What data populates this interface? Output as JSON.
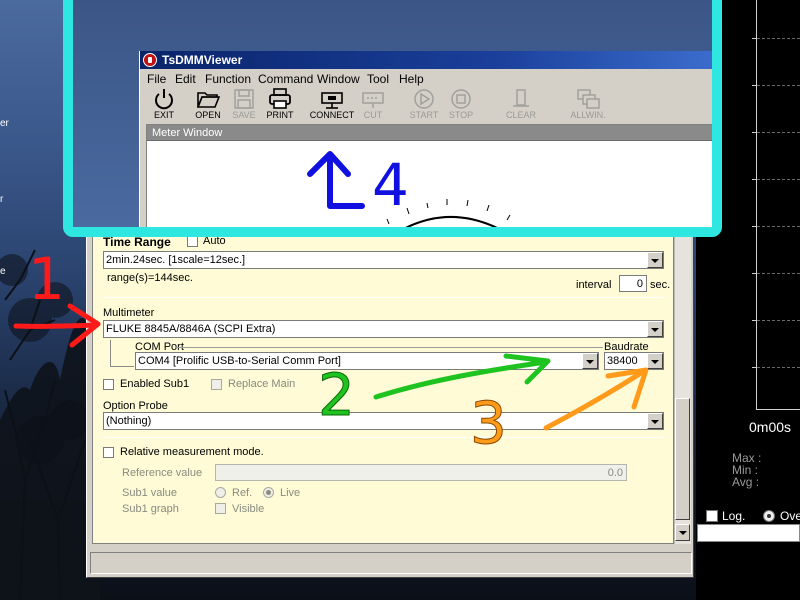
{
  "desktop": {
    "side_texts": [
      "er",
      "r",
      "e"
    ]
  },
  "app": {
    "title": "TsDMMViewer",
    "menu": [
      "File",
      "Edit",
      "Function",
      "Command",
      "Window",
      "Tool",
      "Help"
    ],
    "toolbar": [
      {
        "label": "EXIT",
        "icon": "power-icon",
        "enabled": true
      },
      {
        "label": "OPEN",
        "icon": "folder-open-icon",
        "enabled": true
      },
      {
        "label": "SAVE",
        "icon": "floppy-save-icon",
        "enabled": false
      },
      {
        "label": "PRINT",
        "icon": "printer-icon",
        "enabled": true
      },
      {
        "label": "CONNECT",
        "icon": "connect-cable-icon",
        "enabled": true
      },
      {
        "label": "CUT",
        "icon": "disconnect-cable-icon",
        "enabled": false
      },
      {
        "label": "START",
        "icon": "play-icon",
        "enabled": false
      },
      {
        "label": "STOP",
        "icon": "stop-icon",
        "enabled": false
      },
      {
        "label": "CLEAR",
        "icon": "trash-icon",
        "enabled": false
      },
      {
        "label": "ALLWIN.",
        "icon": "windows-icon",
        "enabled": false
      }
    ],
    "meter_window_title": "Meter Window"
  },
  "settings": {
    "time_range_label": "Time Range",
    "auto_label": "Auto",
    "time_range_value": "2min.24sec. [1scale=12sec.]",
    "range_text": "range(s)=144sec.",
    "interval_label": "interval",
    "interval_value": "0",
    "interval_unit": "sec.",
    "multimeter_label": "Multimeter",
    "multimeter_value": "FLUKE 8845A/8846A (SCPI Extra)",
    "com_port_label": "COM Port",
    "com_port_value": "COM4 [Prolific USB-to-Serial Comm Port]",
    "baudrate_label": "Baudrate",
    "baudrate_value": "38400",
    "enabled_sub1_label": "Enabled Sub1",
    "replace_main_label": "Replace Main",
    "option_probe_label": "Option Probe",
    "option_probe_value": "(Nothing)",
    "relative_label": "Relative measurement mode.",
    "reference_label": "Reference value",
    "reference_value": "0.0",
    "sub1_value_label": "Sub1 value",
    "ref_label": "Ref.",
    "live_label": "Live",
    "sub1_graph_label": "Sub1 graph",
    "visible_label": "Visible"
  },
  "graph_window": {
    "time_label": "0m00s",
    "max_label": "Max",
    "min_label": "Min",
    "avg_label": "Avg",
    "log_label": "Log.",
    "over_label": "Ove"
  },
  "annotations": {
    "items": [
      {
        "number": "1",
        "color": "#ff1a1a"
      },
      {
        "number": "2",
        "color": "#1fc31f"
      },
      {
        "number": "3",
        "color": "#ff9a1a"
      },
      {
        "number": "4",
        "color": "#1010e0"
      }
    ]
  }
}
